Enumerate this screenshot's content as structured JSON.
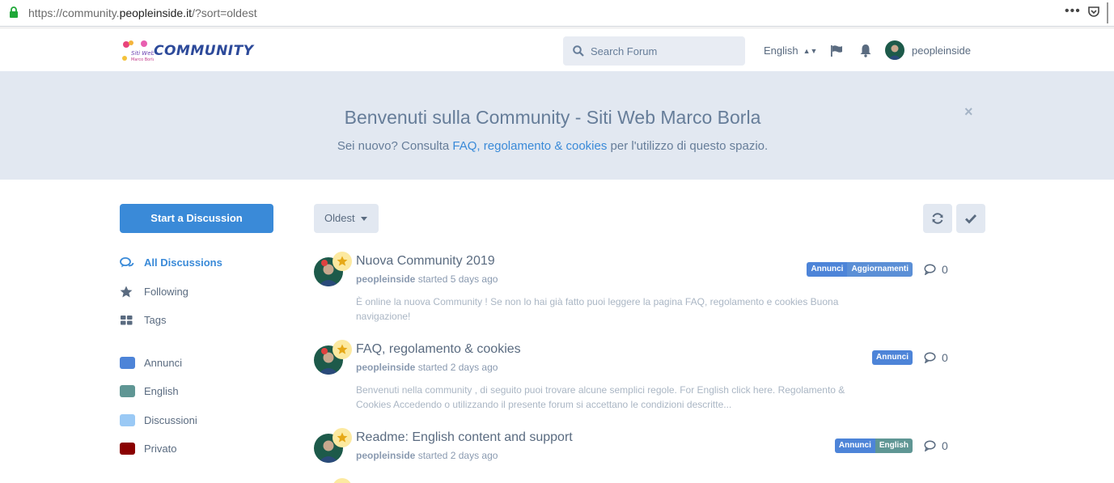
{
  "browser": {
    "url_prefix": "https://community.",
    "url_domain": "peopleinside.it",
    "url_suffix": "/?sort=oldest"
  },
  "header": {
    "logo_text": "COMMUNITY",
    "search_placeholder": "Search Forum",
    "language": "English",
    "username": "peopleinside"
  },
  "hero": {
    "title": "Benvenuti sulla Community - Siti Web Marco Borla",
    "sub_before": "Sei nuovo? Consulta ",
    "sub_link": "FAQ, regolamento & cookies",
    "sub_after": " per l'utilizzo di questo spazio.",
    "close": "×"
  },
  "sidebar": {
    "start_button": "Start a Discussion",
    "nav": [
      {
        "label": "All Discussions",
        "icon": "comments-icon",
        "active": true
      },
      {
        "label": "Following",
        "icon": "star-icon"
      },
      {
        "label": "Tags",
        "icon": "tags-grid-icon"
      }
    ],
    "tags": [
      {
        "label": "Annunci",
        "color": "#4d84d8"
      },
      {
        "label": "English",
        "color": "#5f9694"
      },
      {
        "label": "Discussioni",
        "color": "#9ac9f5"
      },
      {
        "label": "Privato",
        "color": "#8a0000"
      }
    ]
  },
  "toolbar": {
    "sort_label": "Oldest",
    "refresh_icon": "refresh-icon",
    "mark_read_icon": "check-icon"
  },
  "discussions": [
    {
      "title": "Nuova Community 2019",
      "author": "peopleinside",
      "started": " started 5 days ago",
      "excerpt": "È online la nuova Community ! Se non lo hai già fatto puoi leggere la pagina FAQ, regolamento e cookies Buona navigazione!",
      "tags": [
        {
          "label": "Annunci",
          "color": "#4d84d8"
        },
        {
          "label": "Aggiornamenti",
          "color": "#5b8fd6"
        }
      ],
      "replies": "0"
    },
    {
      "title": "FAQ, regolamento & cookies",
      "author": "peopleinside",
      "started": " started 2 days ago",
      "excerpt": "Benvenuti nella community , di seguito puoi trovare alcune semplici regole. For English click here. Regolamento & Cookies Accedendo o utilizzando il presente forum si accettano le condizioni descritte...",
      "tags": [
        {
          "label": "Annunci",
          "color": "#4d84d8"
        }
      ],
      "replies": "0"
    },
    {
      "title": "Readme: English content and support",
      "author": "peopleinside",
      "started": " started 2 days ago",
      "excerpt": "",
      "tags": [
        {
          "label": "Annunci",
          "color": "#4d84d8"
        },
        {
          "label": "English",
          "color": "#5f9694"
        }
      ],
      "replies": "0"
    }
  ]
}
